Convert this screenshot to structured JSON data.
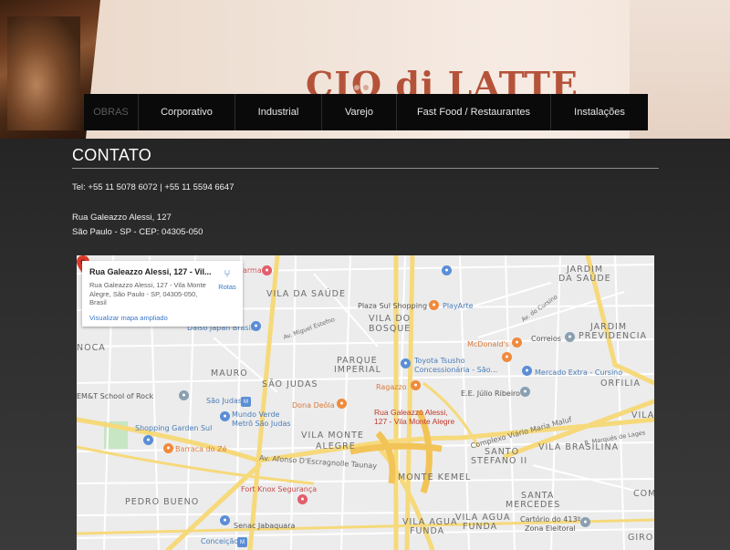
{
  "nav": {
    "items": [
      {
        "label": "OBRAS",
        "active": true
      },
      {
        "label": "Corporativo",
        "active": false
      },
      {
        "label": "Industrial",
        "active": false
      },
      {
        "label": "Varejo",
        "active": false
      },
      {
        "label": "Fast Food / Restaurantes",
        "active": false
      },
      {
        "label": "Instalações",
        "active": false
      }
    ]
  },
  "hero": {
    "sign_text": "CIO di LATTE"
  },
  "contact": {
    "title": "CONTATO",
    "phone": "Tel: +55 11 5078 6072 | +55 11 5594 6647",
    "address_line1": "Rua Galeazzo Alessi, 127",
    "address_line2": "São Paulo - SP - CEP: 04305-050"
  },
  "map": {
    "card": {
      "title": "Rua Galeazzo Alessi, 127 - Vil...",
      "address": "Rua Galeazzo Alessi, 127 - Vila Monte Alegre, São Paulo - SP, 04305-050, Brasil",
      "route_label": "Rotas",
      "view_larger": "Visualizar mapa ampliado"
    },
    "pin_label_line1": "Rua Galeazzo Alessi,",
    "pin_label_line2": "127 - Vila Monte Alegre",
    "districts": {
      "vila_da_saude": "VILA DA SAÚDE",
      "jardim_da_saude": "JARDIM DA SAÚDE",
      "vila_do": "VILA DO",
      "bosque": "BOSQUE",
      "parque": "PARQUE",
      "imperial": "IMPERIAL",
      "mauro": "MAURO",
      "sao_judas": "SÃO JUDAS",
      "vila_monte": "VILA MONTE",
      "alegre": "ALEGRE",
      "jardim_previdencia_1": "JARDIM",
      "jardim_previdencia_2": "PREVIDENCIA",
      "orfilia": "ORFILIA",
      "vila_brasilina": "VILA BRASILINA",
      "santo": "SANTO",
      "stefano": "STEFANO II",
      "monte_kemel": "MONTE KEMEL",
      "pedro_bueno": "PEDRO BUENO",
      "santa": "SANTA",
      "mercedes": "MERCEDES",
      "vila_agua_1": "VILA AGUA",
      "funda_1": "FUNDA",
      "vila_agua_2": "VILA AGUA",
      "funda_2": "FUNDA",
      "noca": "NOCA",
      "jardim_top_1": "JARDIM",
      "jardim_top_2": "DA SAÚDE",
      "vila_right": "VILA",
      "girou": "GIROU",
      "comb": "COMB"
    },
    "pois": {
      "plaza_sul": "Plaza Sul Shopping",
      "playarte": "PlayArte",
      "mcdonalds": "McDonald's",
      "correios": "Correios",
      "toyota_1": "Toyota Tsusho",
      "toyota_2": "Concessionária - São...",
      "mercado_extra": "Mercado Extra - Cursino",
      "ragazzo": "Ragazzo",
      "ee_julio": "E.E. Júlio Ribeiro",
      "emt": "EM&T School of Rock",
      "sao_judas_metro": "São Judas",
      "dona_deola": "Dona Deôla",
      "mundo_verde_1": "Mundo Verde",
      "mundo_verde_2": "Metrô São Judas",
      "shopping_garden": "Shopping Garden Sul",
      "barraca": "Barraca do Zé",
      "daiso": "Daiso Japan Brasil",
      "fort_knox": "Fort Knox Segurança",
      "senac": "Senac Jabaquara",
      "conceicao": "Conceição",
      "cartorio_1": "Cartório do 413º",
      "cartorio_2": "Zona Eleitoral",
      "farma": "arma"
    },
    "streets": {
      "complexo": "Complexo Viário Maria Maluf",
      "afonso": "Av. Afonso D'Escragnolle Taunay",
      "miguel": "Av. Miguel Estefno",
      "cursino": "Av. do Cursino",
      "marques": "R. Marquês de Lages"
    }
  }
}
